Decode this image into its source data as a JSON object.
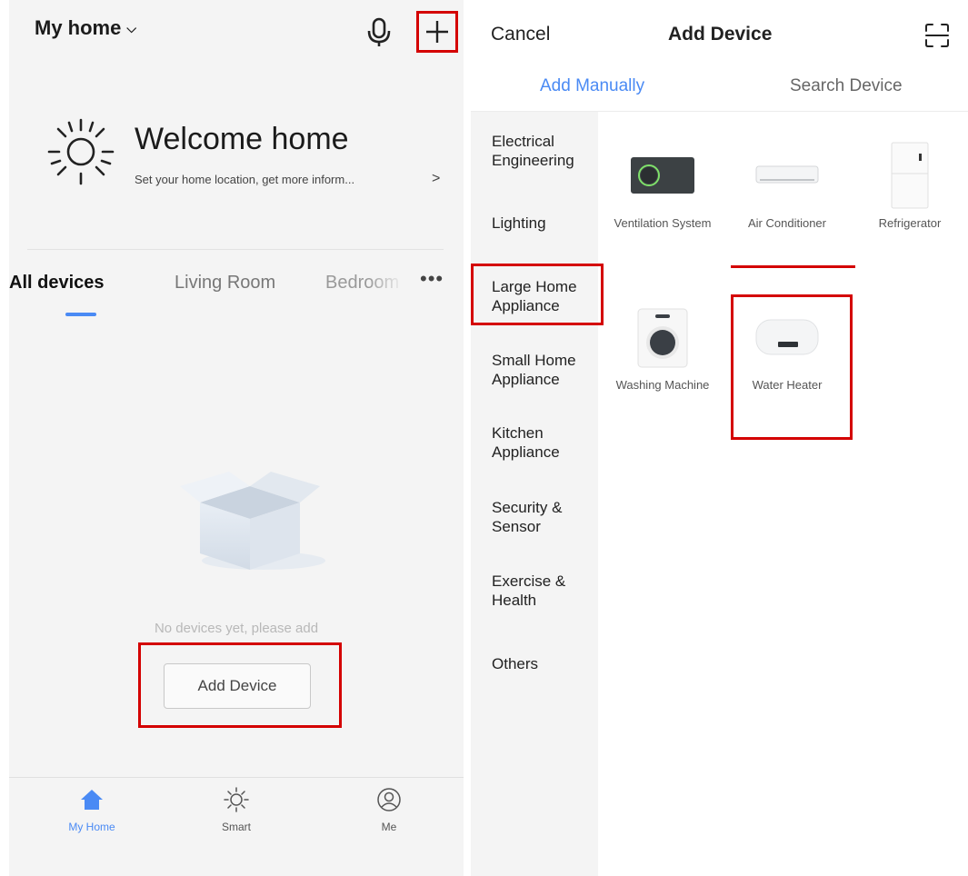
{
  "home": {
    "title": "My home",
    "welcome_title": "Welcome home",
    "welcome_subtitle": "Set your home location, get more inform...",
    "welcome_arrow": ">",
    "tabs": [
      {
        "label": "All devices"
      },
      {
        "label": "Living Room"
      },
      {
        "label": "Bedroom"
      }
    ],
    "more": "•••",
    "empty_text": "No devices yet, please add",
    "add_device_label": "Add Device",
    "nav": [
      {
        "label": "My Home",
        "icon": "home-icon"
      },
      {
        "label": "Smart",
        "icon": "sun-icon"
      },
      {
        "label": "Me",
        "icon": "user-icon"
      }
    ]
  },
  "add_device": {
    "cancel_label": "Cancel",
    "title": "Add Device",
    "tabs": [
      {
        "label": "Add Manually"
      },
      {
        "label": "Search Device"
      }
    ],
    "categories": [
      {
        "label": "Electrical Engineering"
      },
      {
        "label": "Lighting"
      },
      {
        "label": "Large Home Appliance"
      },
      {
        "label": "Small Home Appliance"
      },
      {
        "label": "Kitchen Appliance"
      },
      {
        "label": "Security & Sensor"
      },
      {
        "label": "Exercise & Health"
      },
      {
        "label": "Others"
      }
    ],
    "devices": [
      {
        "label": "Ventilation System"
      },
      {
        "label": "Air Conditioner"
      },
      {
        "label": "Refrigerator"
      },
      {
        "label": "Washing Machine"
      },
      {
        "label": "Water Heater"
      }
    ]
  },
  "colors": {
    "accent": "#4a8af4",
    "highlight": "#d40000",
    "background": "#f4f4f4"
  }
}
